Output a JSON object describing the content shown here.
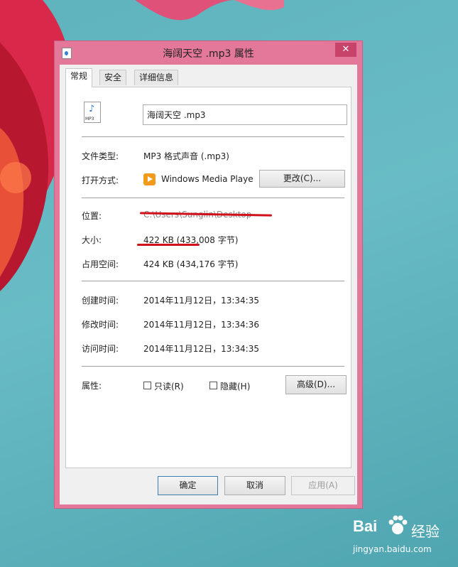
{
  "window": {
    "title": "海阔天空 .mp3 属性",
    "close_glyph": "✕"
  },
  "tabs": [
    {
      "label": "常规",
      "active": true
    },
    {
      "label": "安全",
      "active": false
    },
    {
      "label": "详细信息",
      "active": false
    }
  ],
  "general": {
    "icon_label": "MP3",
    "file_name": "海阔天空 .mp3",
    "file_type_label": "文件类型:",
    "file_type_value": "MP3 格式声音 (.mp3)",
    "opens_with_label": "打开方式:",
    "opens_with_value": "Windows Media Playe",
    "change_button": "更改(C)...",
    "location_label": "位置:",
    "location_value": "C:\\Users\\Sunglin\\Desktop",
    "size_label": "大小:",
    "size_value": "422 KB (433,008 字节)",
    "size_on_disk_label": "占用空间:",
    "size_on_disk_value": "424 KB (434,176 字节)",
    "created_label": "创建时间:",
    "created_value": "2014年11月12日，13:34:35",
    "modified_label": "修改时间:",
    "modified_value": "2014年11月12日，13:34:36",
    "accessed_label": "访问时间:",
    "accessed_value": "2014年11月12日，13:34:35",
    "attributes_label": "属性:",
    "readonly_label": "只读(R)",
    "readonly_checked": false,
    "hidden_label": "隐藏(H)",
    "hidden_checked": false,
    "advanced_button": "高级(D)..."
  },
  "footer": {
    "ok": "确定",
    "cancel": "取消",
    "apply": "应用(A)"
  },
  "watermark": {
    "brand": "Bai",
    "brand_suffix": "经验",
    "url": "jingyan.baidu.com"
  },
  "colors": {
    "window_frame": "#e3789b",
    "close_button": "#c8436a",
    "annotation_red": "#d0101a",
    "desktop": "#5fb3bd"
  }
}
